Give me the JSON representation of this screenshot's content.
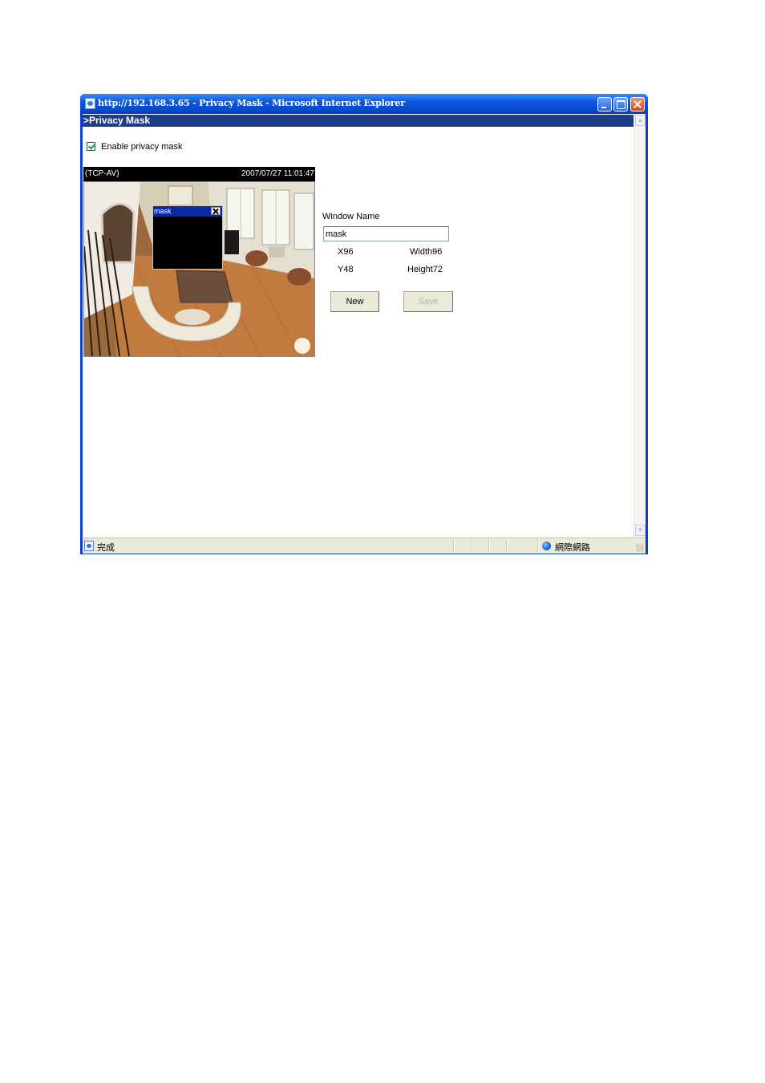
{
  "window": {
    "title": "http://192.168.3.65 - Privacy Mask - Microsoft Internet Explorer"
  },
  "page": {
    "header": ">Privacy Mask",
    "enable_label": "Enable privacy mask",
    "enable_checked": true
  },
  "video": {
    "tag": "(TCP-AV)",
    "timestamp": "2007/07/27 11:01:47",
    "mask_window_name": "mask"
  },
  "form": {
    "window_name_label": "Window Name",
    "window_name_value": "mask",
    "x_label": "X96",
    "width_label": "Width96",
    "y_label": "Y48",
    "height_label": "Height72",
    "new_button": "New",
    "save_button": "Save"
  },
  "statusbar": {
    "status_text": "完成",
    "zone_text": "網際網路"
  },
  "icons": {
    "title": "ie-page-icon",
    "minimize": "minimize-icon",
    "maximize": "maximize-icon",
    "close": "close-icon",
    "checkbox": "checkbox-checked-icon",
    "mask_close": "close-icon",
    "status": "ie-page-icon",
    "zone": "globe-icon"
  },
  "colors": {
    "titlebar": "#0b58e0",
    "page_header": "#1f3c88",
    "mask_titlebar": "#0b2aa0"
  }
}
